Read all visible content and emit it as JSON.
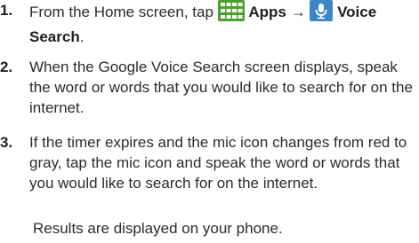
{
  "steps": [
    {
      "number": "1.",
      "prefix": "From the Home screen, tap ",
      "apps_label": "Apps",
      "arrow": " → ",
      "voice_label": "Voice Search",
      "suffix": "."
    },
    {
      "number": "2.",
      "text": "When the Google Voice Search screen displays, speak the word or words that you would like to search for on the internet."
    },
    {
      "number": "3.",
      "text": "If the timer expires and the mic icon changes from red to gray, tap the mic icon and speak the word or words that you would like to search for on the internet."
    }
  ],
  "note": "Results are displayed on your phone.",
  "icons": {
    "apps": "apps-grid-icon",
    "voice": "microphone-icon"
  },
  "colors": {
    "apps_icon": "#4aa02c",
    "voice_icon": "#3d86c6",
    "text": "#2b2b2b"
  }
}
